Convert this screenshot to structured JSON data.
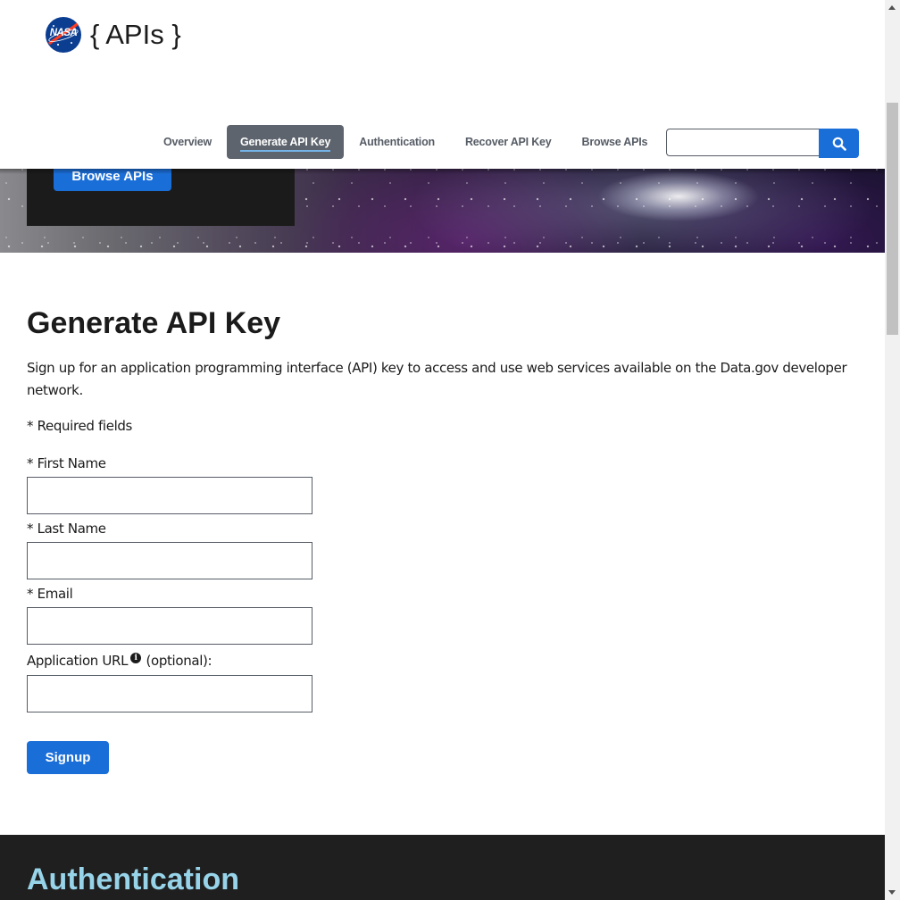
{
  "header": {
    "logo_text": "{ APIs }",
    "logo_badge_text": "NASA",
    "nav": [
      {
        "label": "Overview",
        "active": false
      },
      {
        "label": "Generate API Key",
        "active": true
      },
      {
        "label": "Authentication",
        "active": false
      },
      {
        "label": "Recover API Key",
        "active": false
      },
      {
        "label": "Browse APIs",
        "active": false
      }
    ],
    "search": {
      "value": "",
      "icon": "search-icon"
    }
  },
  "hero": {
    "button_label": "Browse APIs"
  },
  "main": {
    "title": "Generate API Key",
    "intro": "Sign up for an application programming interface (API) key to access and use web services available on the Data.gov developer network.",
    "required_note": "* Required fields",
    "fields": {
      "first_name": {
        "label": "* First Name",
        "value": ""
      },
      "last_name": {
        "label": "* Last Name",
        "value": ""
      },
      "email": {
        "label": "* Email",
        "value": ""
      },
      "app_url": {
        "label": "Application URL",
        "suffix": "(optional):",
        "value": "",
        "info_icon": "info-icon"
      }
    },
    "submit_label": "Signup"
  },
  "next_section": {
    "title": "Authentication"
  },
  "colors": {
    "primary_button": "#1a6ed8",
    "active_nav": "#5d646d",
    "dark_section": "#1f1f1f",
    "section_title_accent": "#97d4ea"
  }
}
